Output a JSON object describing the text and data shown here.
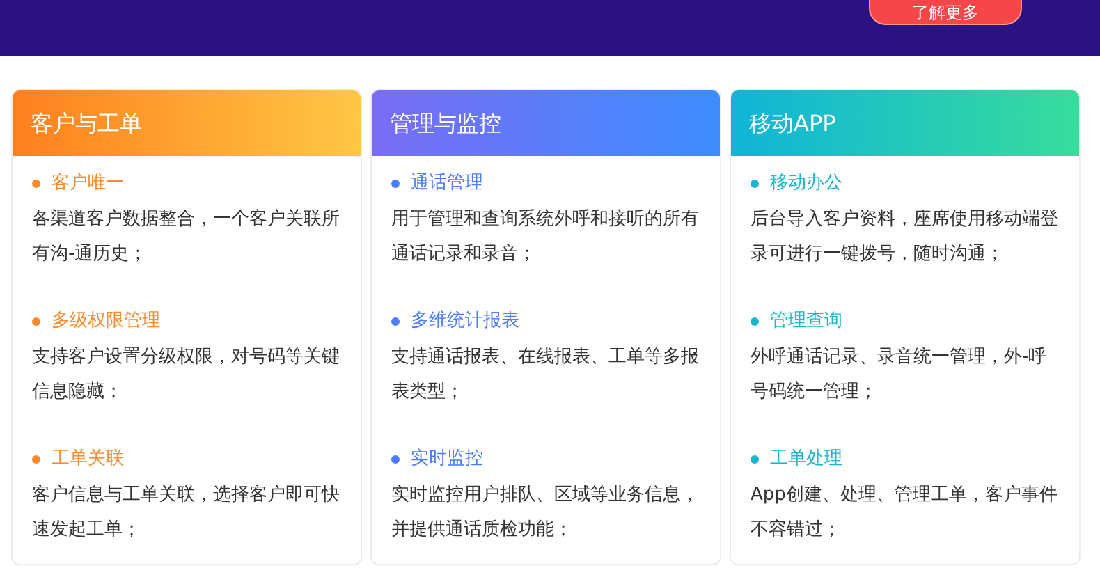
{
  "banner": {
    "button": "了解更多"
  },
  "cards": [
    {
      "title": "客户与工单",
      "color": "#ff8a2b",
      "features": [
        {
          "name": "客户唯一",
          "desc": "各渠道客户数据整合，一个客户关联所有沟-通历史；"
        },
        {
          "name": "多级权限管理",
          "desc": "支持客户设置分级权限，对号码等关键信息隐藏；"
        },
        {
          "name": "工单关联",
          "desc": "客户信息与工单关联，选择客户即可快速发起工单；"
        }
      ]
    },
    {
      "title": "管理与监控",
      "color": "#4a7dff",
      "features": [
        {
          "name": "通话管理",
          "desc": "用于管理和查询系统外呼和接听的所有通话记录和录音；"
        },
        {
          "name": "多维统计报表",
          "desc": "支持通话报表、在线报表、工单等多报表类型；"
        },
        {
          "name": "实时监控",
          "desc": "实时监控用户排队、区域等业务信息，并提供通话质检功能；"
        }
      ]
    },
    {
      "title": "移动APP",
      "color": "#1ab6d0",
      "features": [
        {
          "name": "移动办公",
          "desc": "后台导入客户资料，座席使用移动端登录可进行一键拨号，随时沟通；"
        },
        {
          "name": "管理查询",
          "desc": "外呼通话记录、录音统一管理，外-呼号码统一管理；"
        },
        {
          "name": "工单处理",
          "desc": "App创建、处理、管理工单，客户事件不容错过；"
        }
      ]
    }
  ]
}
